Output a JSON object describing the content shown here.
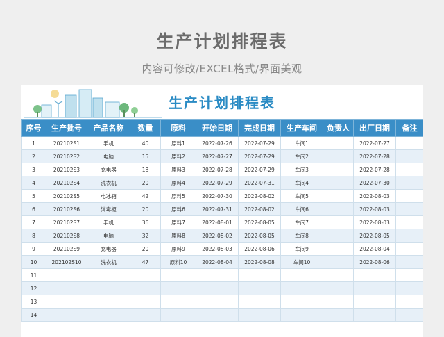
{
  "page": {
    "title": "生产计划排程表",
    "subtitle": "内容可修改/EXCEL格式/界面美观"
  },
  "sheet": {
    "title": "生产计划排程表",
    "banner_icon": "city-buildings-icon"
  },
  "colors": {
    "header_bg": "#3a8ec7",
    "title_blue": "#2a8bc4",
    "alt_row": "#e7f0f8",
    "background": "#efefef"
  },
  "table": {
    "headers": [
      "序号",
      "生产批号",
      "产品名称",
      "数量",
      "原料",
      "开始日期",
      "完成日期",
      "生产车间",
      "负责人",
      "出厂日期",
      "备注"
    ],
    "rows": [
      [
        "1",
        "202102S1",
        "手机",
        "40",
        "原料1",
        "2022-07-26",
        "2022-07-29",
        "车间1",
        "",
        "2022-07-27",
        ""
      ],
      [
        "2",
        "202102S2",
        "电脑",
        "15",
        "原料2",
        "2022-07-27",
        "2022-07-29",
        "车间2",
        "",
        "2022-07-28",
        ""
      ],
      [
        "3",
        "202102S3",
        "充电器",
        "18",
        "原料3",
        "2022-07-28",
        "2022-07-29",
        "车间3",
        "",
        "2022-07-28",
        ""
      ],
      [
        "4",
        "202102S4",
        "洗衣机",
        "20",
        "原料4",
        "2022-07-29",
        "2022-07-31",
        "车间4",
        "",
        "2022-07-30",
        ""
      ],
      [
        "5",
        "202102S5",
        "电冰箱",
        "42",
        "原料5",
        "2022-07-30",
        "2022-08-02",
        "车间5",
        "",
        "2022-08-03",
        ""
      ],
      [
        "6",
        "202102S6",
        "消毒柜",
        "20",
        "原料6",
        "2022-07-31",
        "2022-08-02",
        "车间6",
        "",
        "2022-08-03",
        ""
      ],
      [
        "7",
        "202102S7",
        "手机",
        "36",
        "原料7",
        "2022-08-01",
        "2022-08-05",
        "车间7",
        "",
        "2022-08-03",
        ""
      ],
      [
        "8",
        "202102S8",
        "电脑",
        "32",
        "原料8",
        "2022-08-02",
        "2022-08-05",
        "车间8",
        "",
        "2022-08-05",
        ""
      ],
      [
        "9",
        "202102S9",
        "充电器",
        "20",
        "原料9",
        "2022-08-03",
        "2022-08-06",
        "车间9",
        "",
        "2022-08-04",
        ""
      ],
      [
        "10",
        "202102S10",
        "洗衣机",
        "47",
        "原料10",
        "2022-08-04",
        "2022-08-08",
        "车间10",
        "",
        "2022-08-06",
        ""
      ],
      [
        "11",
        "",
        "",
        "",
        "",
        "",
        "",
        "",
        "",
        "",
        ""
      ],
      [
        "12",
        "",
        "",
        "",
        "",
        "",
        "",
        "",
        "",
        "",
        ""
      ],
      [
        "13",
        "",
        "",
        "",
        "",
        "",
        "",
        "",
        "",
        "",
        ""
      ],
      [
        "14",
        "",
        "",
        "",
        "",
        "",
        "",
        "",
        "",
        "",
        ""
      ]
    ]
  }
}
